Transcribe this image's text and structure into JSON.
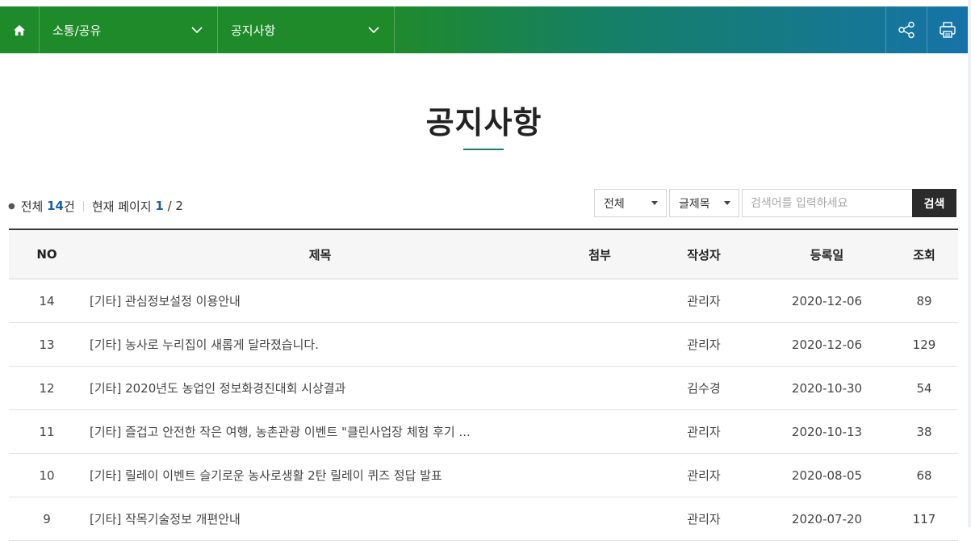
{
  "nav": {
    "home_icon": "home-icon",
    "crumbs": [
      {
        "label": "소통/공유",
        "icon": "chevron-down-icon"
      },
      {
        "label": "공지사항",
        "icon": "chevron-down-icon"
      }
    ],
    "tools": [
      "share-icon",
      "print-icon"
    ]
  },
  "page": {
    "title": "공지사항"
  },
  "summary": {
    "total_label": "전체",
    "total_count": "14",
    "total_unit": "건",
    "page_label": "현재 페이지",
    "current_page": "1",
    "page_sep": " / ",
    "total_pages": "2"
  },
  "search": {
    "category": "전체",
    "field": "글제목",
    "placeholder": "검색어를 입력하세요",
    "button": "검색"
  },
  "table": {
    "headers": [
      "NO",
      "제목",
      "첨부",
      "작성자",
      "등록일",
      "조회"
    ],
    "rows": [
      {
        "no": "14",
        "title": "[기타] 관심정보설정 이용안내",
        "attach": "",
        "author": "관리자",
        "date": "2020-12-06",
        "views": "89"
      },
      {
        "no": "13",
        "title": "[기타] 농사로 누리집이 새롭게 달라졌습니다.",
        "attach": "",
        "author": "관리자",
        "date": "2020-12-06",
        "views": "129"
      },
      {
        "no": "12",
        "title": "[기타] 2020년도 농업인 정보화경진대회 시상결과",
        "attach": "",
        "author": "김수경",
        "date": "2020-10-30",
        "views": "54"
      },
      {
        "no": "11",
        "title": "[기타] 즐겁고 안전한 작은 여행, 농촌관광 이벤트 \"클린사업장 체험 후기 ...",
        "attach": "",
        "author": "관리자",
        "date": "2020-10-13",
        "views": "38"
      },
      {
        "no": "10",
        "title": "[기타] 릴레이 이벤트 슬기로운 농사로생활 2탄 릴레이 퀴즈 정답 발표",
        "attach": "",
        "author": "관리자",
        "date": "2020-08-05",
        "views": "68"
      },
      {
        "no": "9",
        "title": "[기타] 작목기술정보 개편안내",
        "attach": "",
        "author": "관리자",
        "date": "2020-07-20",
        "views": "117"
      }
    ]
  }
}
